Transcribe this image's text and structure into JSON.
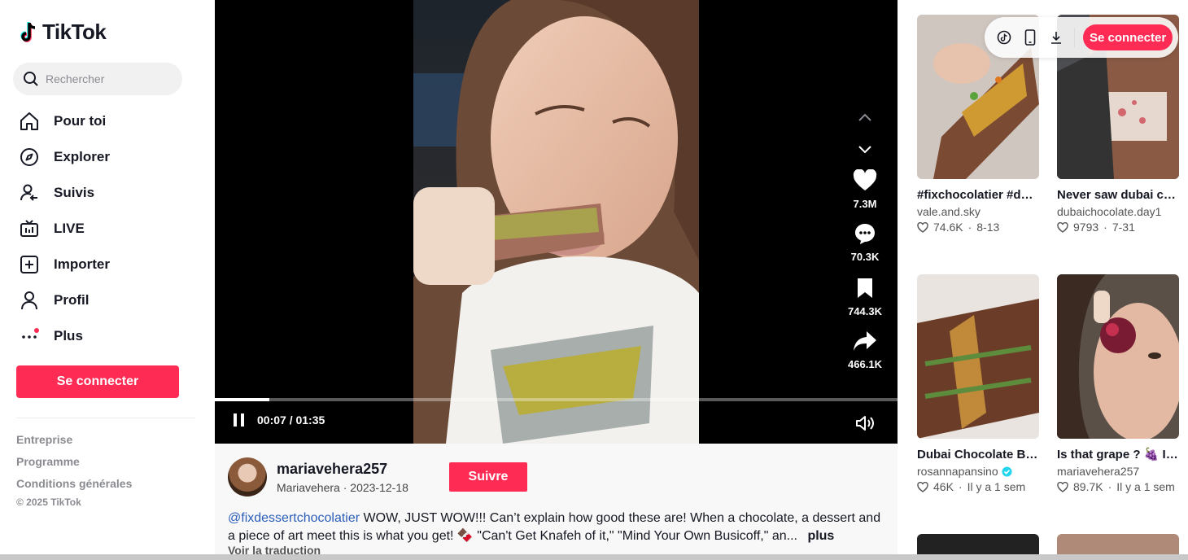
{
  "brand": {
    "name": "TikTok"
  },
  "search": {
    "placeholder": "Rechercher"
  },
  "nav": {
    "items": [
      {
        "label": "Pour toi",
        "icon": "home-icon"
      },
      {
        "label": "Explorer",
        "icon": "compass-icon"
      },
      {
        "label": "Suivis",
        "icon": "following-icon"
      },
      {
        "label": "LIVE",
        "icon": "live-tv-icon"
      },
      {
        "label": "Importer",
        "icon": "upload-plus-icon"
      },
      {
        "label": "Profil",
        "icon": "profile-icon"
      },
      {
        "label": "Plus",
        "icon": "more-dots-icon"
      }
    ]
  },
  "sidebar": {
    "login_label": "Se connecter",
    "footer_links": [
      "Entreprise",
      "Programme",
      "Conditions générales"
    ],
    "copyright": "© 2025 TikTok"
  },
  "video": {
    "likes": "7.3M",
    "comments": "70.3K",
    "saves": "744.3K",
    "shares": "466.1K",
    "time": "00:07 / 01:35",
    "progress": 0.08
  },
  "author": {
    "username": "mariavehera257",
    "display_name": "Mariavehera",
    "date": "2023-12-18",
    "follow_label": "Suivre"
  },
  "description": {
    "mention": "@fixdessertchocolatier",
    "text": "WOW, JUST WOW!!! Can’t explain how good these are! When a chocolate, a dessert and a piece of art meet this is what you get! 🍫 \"Can't Get Knafeh of it,\" \"Mind Your Own Busicoff,\" an...",
    "more_label": "plus",
    "translate_label": "Voir la traduction"
  },
  "top_bar": {
    "login_label": "Se connecter"
  },
  "recommended": [
    {
      "title": "#fixchocolatier #dubaichocolate...",
      "author": "vale.and.sky",
      "likes": "74.6K",
      "date": "8-13",
      "verified": false
    },
    {
      "title": "Never saw dubai chocolate like this...",
      "author": "dubaichocolate.day1",
      "likes": "9793",
      "date": "7-31",
      "verified": false
    },
    {
      "title": "Dubai Chocolate Bars From Scratch...",
      "author": "rosannapansino",
      "likes": "46K",
      "date": "Il y a 1 sem",
      "verified": true
    },
    {
      "title": "Is that grape ? 🍇 I’m wondering And...",
      "author": "mariavehera257",
      "likes": "89.7K",
      "date": "Il y a 1 sem",
      "verified": false
    }
  ],
  "colors": {
    "accent": "#fe2c55",
    "mention": "#2b5db9",
    "verified": "#20d5ec"
  }
}
